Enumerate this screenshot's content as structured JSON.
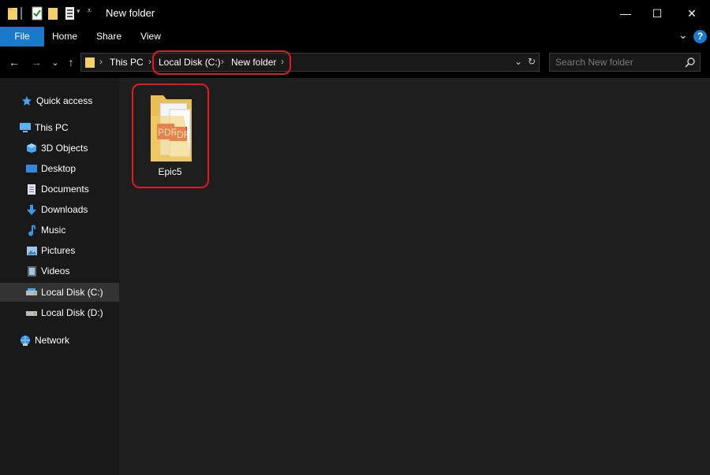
{
  "window": {
    "title": "New folder",
    "controls": {
      "minimize": "—",
      "maximize": "☐",
      "close": "✕"
    }
  },
  "ribbon": {
    "tabs": [
      {
        "label": "File",
        "active": true
      },
      {
        "label": "Home"
      },
      {
        "label": "Share"
      },
      {
        "label": "View"
      }
    ],
    "expand_glyph": "⌄",
    "help_glyph": "?"
  },
  "navigation": {
    "back": "←",
    "forward": "→",
    "recent": "⌄",
    "up": "↑",
    "breadcrumbs": [
      "This PC",
      "Local Disk (C:)",
      "New folder"
    ],
    "separator": "›",
    "dropdown_glyph": "⌄",
    "refresh_glyph": "↻"
  },
  "search": {
    "placeholder": "Search New folder"
  },
  "sidebar": {
    "items": [
      {
        "label": "Quick access",
        "icon": "star-icon"
      },
      {
        "label": "This PC",
        "icon": "computer-icon"
      },
      {
        "label": "3D Objects",
        "icon": "cube-icon"
      },
      {
        "label": "Desktop",
        "icon": "desktop-icon"
      },
      {
        "label": "Documents",
        "icon": "document-icon"
      },
      {
        "label": "Downloads",
        "icon": "download-icon"
      },
      {
        "label": "Music",
        "icon": "music-icon"
      },
      {
        "label": "Pictures",
        "icon": "pictures-icon"
      },
      {
        "label": "Videos",
        "icon": "video-icon"
      },
      {
        "label": "Local Disk (C:)",
        "icon": "drive-icon",
        "selected": true
      },
      {
        "label": "Local Disk (D:)",
        "icon": "drive-icon"
      },
      {
        "label": "Network",
        "icon": "network-icon"
      }
    ]
  },
  "files": [
    {
      "name": "Epic5",
      "icon": "pdf-folder-icon",
      "badge_text": "PDF"
    }
  ],
  "colors": {
    "accent": "#1979ca",
    "highlight": "#e01b24",
    "folder": "#f2cf6b",
    "pdf": "#d9252b"
  }
}
